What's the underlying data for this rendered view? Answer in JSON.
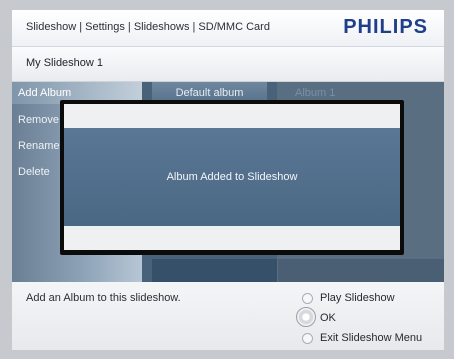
{
  "header": {
    "breadcrumb": "Slideshow | Settings | Slideshows | SD/MMC Card",
    "brand": "PHILIPS"
  },
  "subheader": {
    "title": "My Slideshow 1"
  },
  "menu": {
    "items": [
      {
        "label": "Add Album",
        "selected": true
      },
      {
        "label": "Remove"
      },
      {
        "label": "Rename"
      },
      {
        "label": "Delete"
      }
    ]
  },
  "albums": {
    "items": [
      {
        "label": "Default album"
      },
      {
        "label": "Album 1"
      }
    ]
  },
  "dialog": {
    "message": "Album Added to Slideshow"
  },
  "footer": {
    "hint": "Add an Album to this slideshow.",
    "options": [
      {
        "label": "Play Slideshow"
      },
      {
        "label": "OK"
      },
      {
        "label": "Exit Slideshow Menu"
      }
    ]
  },
  "colors": {
    "brand": "#1e3f89",
    "panel": "#5d7287",
    "dialog_body": "#4a6783"
  }
}
